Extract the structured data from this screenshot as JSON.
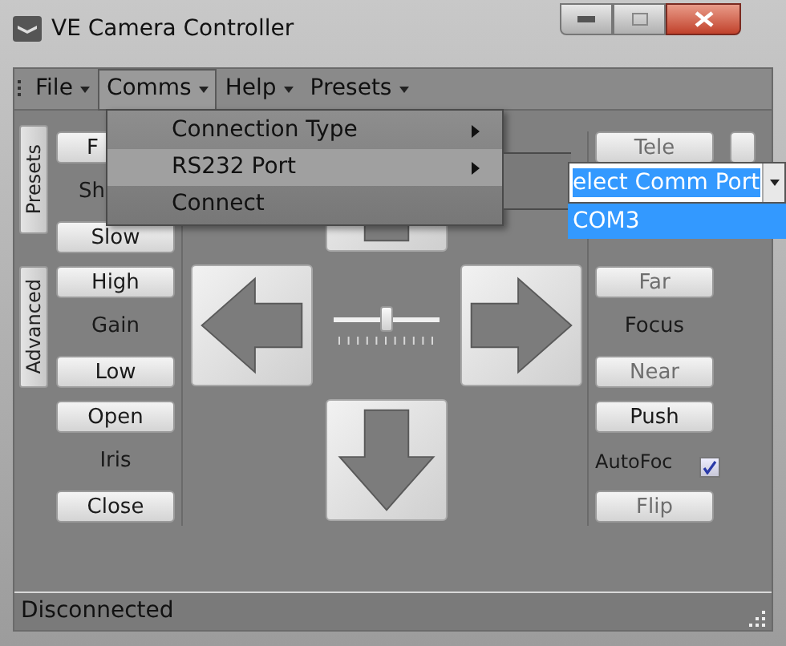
{
  "window": {
    "title": "VE Camera Controller"
  },
  "menu_bar": [
    {
      "label": "File",
      "selected": false
    },
    {
      "label": "Comms",
      "selected": true
    },
    {
      "label": "Help",
      "selected": false
    },
    {
      "label": "Presets",
      "selected": false
    }
  ],
  "comms_menu": [
    {
      "label": "Connection Type",
      "submenu": true,
      "selected": false
    },
    {
      "label": "RS232 Port",
      "submenu": true,
      "selected": true
    },
    {
      "label": "Connect",
      "submenu": false,
      "selected": false
    }
  ],
  "port_dropdown": {
    "value": "elect Comm Port",
    "options": [
      {
        "label": "COM3",
        "selected": true
      }
    ]
  },
  "side_tabs": [
    {
      "label": "Presets"
    },
    {
      "label": "Advanced"
    }
  ],
  "left_controls": [
    {
      "kind": "button",
      "label": "F",
      "disabled": false
    },
    {
      "kind": "label",
      "label": "Sh"
    },
    {
      "kind": "button",
      "label": "Slow",
      "disabled": false
    },
    {
      "kind": "button",
      "label": "High",
      "disabled": false
    },
    {
      "kind": "label",
      "label": "Gain"
    },
    {
      "kind": "button",
      "label": "Low",
      "disabled": false
    },
    {
      "kind": "button",
      "label": "Open",
      "disabled": false
    },
    {
      "kind": "label",
      "label": "Iris"
    },
    {
      "kind": "button",
      "label": "Close",
      "disabled": false
    }
  ],
  "speed_slider": {
    "level": 0.5
  },
  "right_controls": [
    {
      "kind": "button",
      "label": "Tele",
      "disabled": true
    },
    {
      "kind": "spacer"
    },
    {
      "kind": "spacer"
    },
    {
      "kind": "button",
      "label": "Far",
      "disabled": true
    },
    {
      "kind": "label",
      "label": "Focus"
    },
    {
      "kind": "button",
      "label": "Near",
      "disabled": true
    },
    {
      "kind": "button",
      "label": "Push",
      "disabled": false
    },
    {
      "kind": "checkbox",
      "label": "AutoFoc",
      "checked": true
    },
    {
      "kind": "button",
      "label": "Flip",
      "disabled": true
    }
  ],
  "status_bar": "Disconnected"
}
